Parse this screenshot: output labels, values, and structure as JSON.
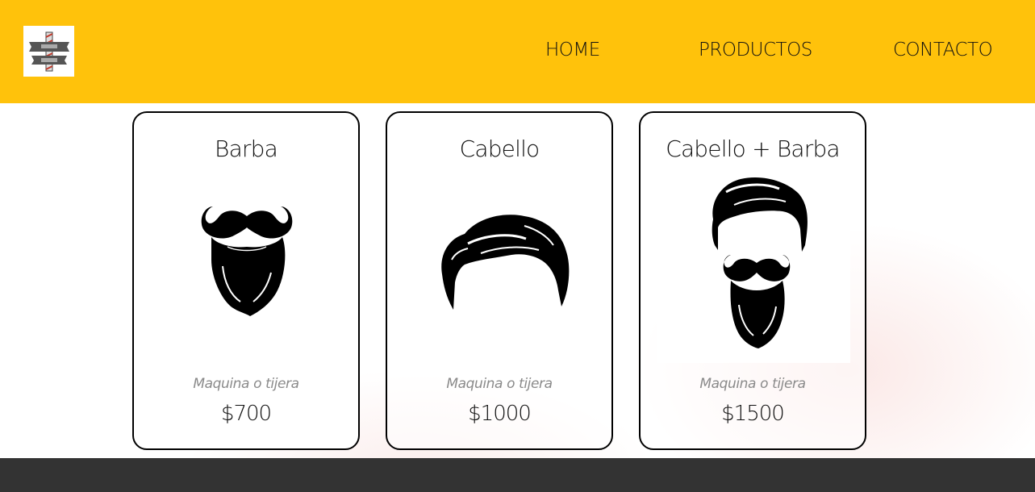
{
  "header": {
    "logo_icon": "barbershop-pole-logo",
    "background_color": "#ffc20b",
    "nav": [
      {
        "label": "HOME"
      },
      {
        "label": "PRODUCTOS"
      },
      {
        "label": "CONTACTO"
      }
    ]
  },
  "cards": [
    {
      "title": "Barba",
      "icon": "beard-icon",
      "description": "Maquina o tijera",
      "price": "$700"
    },
    {
      "title": "Cabello",
      "icon": "hair-icon",
      "description": "Maquina o tijera",
      "price": "$1000"
    },
    {
      "title": "Cabello + Barba",
      "icon": "hair-and-beard-icon",
      "description": "Maquina o tijera",
      "price": "$1500"
    }
  ],
  "footer": {
    "background_color": "#333333"
  }
}
